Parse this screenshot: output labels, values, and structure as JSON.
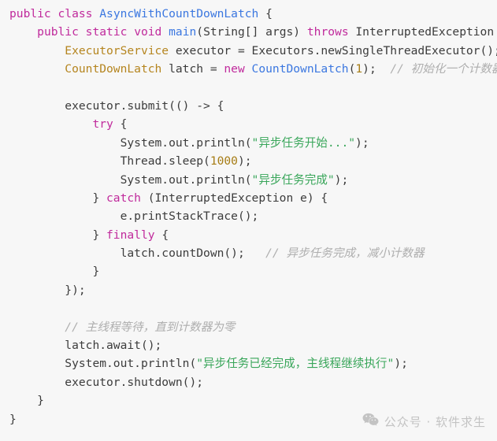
{
  "editor": {
    "language": "java",
    "background_color": "#f7f7f7",
    "colors": {
      "keyword": "#c02a9c",
      "class": "#3b77e0",
      "type": "#b5851f",
      "string": "#39a65a",
      "number": "#a67c14",
      "comment": "#aeaeae",
      "plain": "#3c3c3c"
    }
  },
  "watermark": {
    "icon": "wechat-icon",
    "text": "公众号 · 软件求生"
  },
  "code": {
    "lines": [
      {
        "indent": 0,
        "tokens": [
          {
            "t": "kw",
            "v": "public"
          },
          {
            "t": "pln",
            "v": " "
          },
          {
            "t": "kw",
            "v": "class"
          },
          {
            "t": "pln",
            "v": " "
          },
          {
            "t": "cls",
            "v": "AsyncWithCountDownLatch"
          },
          {
            "t": "pln",
            "v": " {"
          }
        ]
      },
      {
        "indent": 1,
        "tokens": [
          {
            "t": "kw",
            "v": "public"
          },
          {
            "t": "pln",
            "v": " "
          },
          {
            "t": "kw",
            "v": "static"
          },
          {
            "t": "pln",
            "v": " "
          },
          {
            "t": "kw",
            "v": "void"
          },
          {
            "t": "pln",
            "v": " "
          },
          {
            "t": "cls",
            "v": "main"
          },
          {
            "t": "pln",
            "v": "(String[] args) "
          },
          {
            "t": "kw",
            "v": "throws"
          },
          {
            "t": "pln",
            "v": " InterruptedException {"
          }
        ]
      },
      {
        "indent": 2,
        "tokens": [
          {
            "t": "type",
            "v": "ExecutorService"
          },
          {
            "t": "pln",
            "v": " executor = Executors.newSingleThreadExecutor();"
          }
        ]
      },
      {
        "indent": 2,
        "tokens": [
          {
            "t": "type",
            "v": "CountDownLatch"
          },
          {
            "t": "pln",
            "v": " latch = "
          },
          {
            "t": "kw",
            "v": "new"
          },
          {
            "t": "pln",
            "v": " "
          },
          {
            "t": "cls",
            "v": "CountDownLatch"
          },
          {
            "t": "pln",
            "v": "("
          },
          {
            "t": "num",
            "v": "1"
          },
          {
            "t": "pln",
            "v": ");  "
          },
          {
            "t": "cmt",
            "v": "// 初始化一个计数器"
          }
        ]
      },
      {
        "indent": 0,
        "tokens": []
      },
      {
        "indent": 2,
        "tokens": [
          {
            "t": "pln",
            "v": "executor.submit(() -> {"
          }
        ]
      },
      {
        "indent": 3,
        "tokens": [
          {
            "t": "kw",
            "v": "try"
          },
          {
            "t": "pln",
            "v": " {"
          }
        ]
      },
      {
        "indent": 4,
        "tokens": [
          {
            "t": "pln",
            "v": "System.out.println("
          },
          {
            "t": "str",
            "v": "\"异步任务开始...\""
          },
          {
            "t": "pln",
            "v": ");"
          }
        ]
      },
      {
        "indent": 4,
        "tokens": [
          {
            "t": "pln",
            "v": "Thread.sleep("
          },
          {
            "t": "num",
            "v": "1000"
          },
          {
            "t": "pln",
            "v": ");"
          }
        ]
      },
      {
        "indent": 4,
        "tokens": [
          {
            "t": "pln",
            "v": "System.out.println("
          },
          {
            "t": "str",
            "v": "\"异步任务完成\""
          },
          {
            "t": "pln",
            "v": ");"
          }
        ]
      },
      {
        "indent": 3,
        "tokens": [
          {
            "t": "pln",
            "v": "} "
          },
          {
            "t": "kw",
            "v": "catch"
          },
          {
            "t": "pln",
            "v": " (InterruptedException e) {"
          }
        ]
      },
      {
        "indent": 4,
        "tokens": [
          {
            "t": "pln",
            "v": "e.printStackTrace();"
          }
        ]
      },
      {
        "indent": 3,
        "tokens": [
          {
            "t": "pln",
            "v": "} "
          },
          {
            "t": "kw",
            "v": "finally"
          },
          {
            "t": "pln",
            "v": " {"
          }
        ]
      },
      {
        "indent": 4,
        "tokens": [
          {
            "t": "pln",
            "v": "latch.countDown();   "
          },
          {
            "t": "cmt",
            "v": "// 异步任务完成，减小计数器"
          }
        ]
      },
      {
        "indent": 3,
        "tokens": [
          {
            "t": "pln",
            "v": "}"
          }
        ]
      },
      {
        "indent": 2,
        "tokens": [
          {
            "t": "pln",
            "v": "});"
          }
        ]
      },
      {
        "indent": 0,
        "tokens": []
      },
      {
        "indent": 2,
        "tokens": [
          {
            "t": "cmt",
            "v": "// 主线程等待，直到计数器为零"
          }
        ]
      },
      {
        "indent": 2,
        "tokens": [
          {
            "t": "pln",
            "v": "latch.await();"
          }
        ]
      },
      {
        "indent": 2,
        "tokens": [
          {
            "t": "pln",
            "v": "System.out.println("
          },
          {
            "t": "str",
            "v": "\"异步任务已经完成，主线程继续执行\""
          },
          {
            "t": "pln",
            "v": ");"
          }
        ]
      },
      {
        "indent": 2,
        "tokens": [
          {
            "t": "pln",
            "v": "executor.shutdown();"
          }
        ]
      },
      {
        "indent": 1,
        "tokens": [
          {
            "t": "pln",
            "v": "}"
          }
        ]
      },
      {
        "indent": 0,
        "tokens": [
          {
            "t": "pln",
            "v": "}"
          }
        ]
      }
    ]
  }
}
